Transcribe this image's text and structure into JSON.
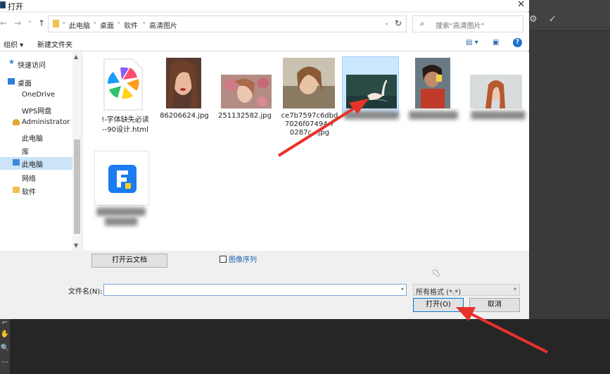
{
  "window": {
    "title": "打开",
    "close": "✕"
  },
  "nav": {
    "back": "←",
    "forward": "→",
    "recent": "⌄",
    "up": "↑"
  },
  "address": {
    "separator": "›",
    "crumbs": [
      "此电脑",
      "桌面",
      "软件",
      "高清图片"
    ],
    "dropdown": "⌄",
    "refresh": "↻"
  },
  "search": {
    "placeholder": "搜索\"高清图片\""
  },
  "toolbar": {
    "organize": "组织 ▾",
    "new_folder": "新建文件夹",
    "help": "?"
  },
  "sidebar": {
    "items": [
      {
        "label": "快速访问",
        "icon": "star-icon"
      },
      {
        "label": "桌面",
        "icon": "desktop-icon"
      },
      {
        "label": "OneDrive",
        "icon": ""
      },
      {
        "label": "WPS网盘",
        "icon": ""
      },
      {
        "label": "Administrator",
        "icon": "user-icon"
      },
      {
        "label": "此电脑",
        "icon": ""
      },
      {
        "label": "库",
        "icon": ""
      },
      {
        "label": "此电脑",
        "icon": "computer-icon"
      },
      {
        "label": "网络",
        "icon": ""
      },
      {
        "label": "软件",
        "icon": "folder-icon"
      }
    ]
  },
  "files": [
    {
      "name": "!-字体缺失必读--90设计.html",
      "line1": "!-字体缺失必读",
      "line2": "--90设计.html",
      "type": "html"
    },
    {
      "name": "86206624.jpg",
      "type": "image"
    },
    {
      "name": "251132582.jpg",
      "type": "image"
    },
    {
      "name": "ce7b7597c6dbd7026f0749428...0287...jpg",
      "line1": "ce7b7597c6dbd",
      "line2": "7026f07494 7",
      "line3": "0287c...jpg",
      "type": "image"
    },
    {
      "name": "",
      "type": "image",
      "selected": true
    },
    {
      "name": "",
      "type": "image"
    },
    {
      "name": "",
      "type": "image"
    },
    {
      "name": "",
      "type": "app"
    }
  ],
  "bottom": {
    "cloud_button": "打开云文档",
    "image_sequence": "图像序列",
    "filename_label": "文件名(N):",
    "filename_value": "",
    "filetype": "所有格式 (*.*)",
    "open_button": "打开(O)",
    "cancel_button": "取消"
  },
  "colors": {
    "accent": "#0078d7",
    "arrow": "#e8322a",
    "selection": "#cce8ff"
  }
}
